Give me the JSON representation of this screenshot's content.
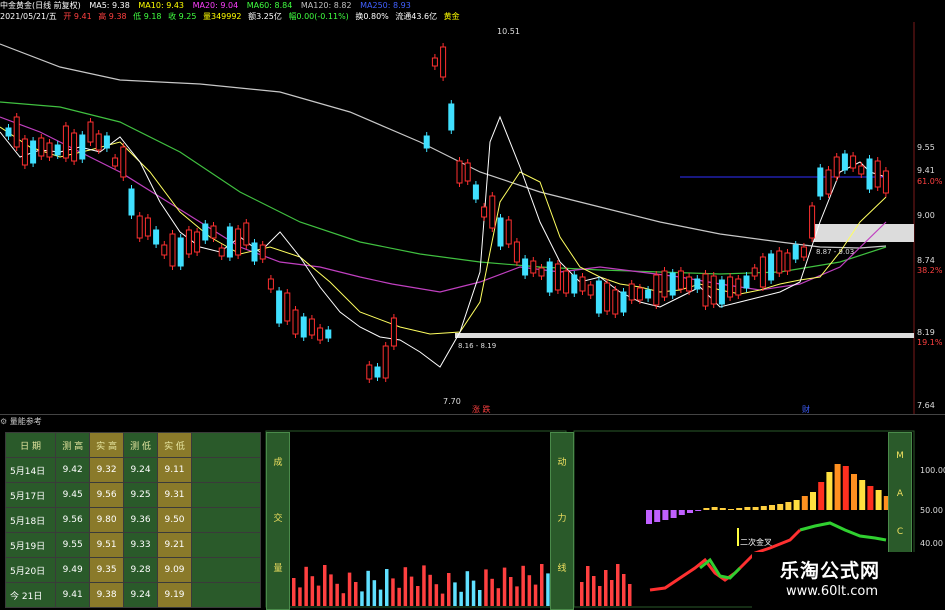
{
  "header": {
    "title": "中金黄金(日线 前复权)",
    "ma5": "MA5: 9.38",
    "ma10": "MA10: 9.43",
    "ma20": "MA20: 9.04",
    "ma60": "MA60: 8.84",
    "ma120": "MA120: 8.82",
    "ma250": "MA250: 8.93",
    "colors": {
      "ma5": "#ffffff",
      "ma10": "#ffff00",
      "ma20": "#ff40ff",
      "ma60": "#40ff40",
      "ma120": "#c0c0c0",
      "ma250": "#4060ff"
    }
  },
  "quote": {
    "date": "2021/05/21/五",
    "open": "开 9.41",
    "high": "高 9.38",
    "low": "低 9.18",
    "close": "收 9.25",
    "volume": "量349992",
    "amount": "额3.25亿",
    "change": "幅0.00(-0.11%)",
    "turnover": "换0.80%",
    "float_mcap": "流通43.6亿",
    "sector": "黄金"
  },
  "axis": {
    "labels": [
      "9.55",
      "9.41",
      "61.0%",
      "9.00",
      "8.74",
      "38.2%",
      "8.19",
      "19.1%",
      "7.64"
    ]
  },
  "chart_annotations": {
    "high_label": "10.51",
    "low_label": "7.70",
    "band1": "8.16 - 8.19",
    "band2": "8.87 - 9.03",
    "marker_red": "涨 跌",
    "marker_blue": "财"
  },
  "panel": {
    "title": "量能参考"
  },
  "table": {
    "headers": [
      "日 期",
      "测 高",
      "实 高",
      "测 低",
      "实 低"
    ],
    "rows": [
      [
        "5月14日",
        "9.42",
        "9.32",
        "9.24",
        "9.11"
      ],
      [
        "5月17日",
        "9.45",
        "9.56",
        "9.25",
        "9.31"
      ],
      [
        "5月18日",
        "9.56",
        "9.80",
        "9.36",
        "9.50"
      ],
      [
        "5月19日",
        "9.55",
        "9.51",
        "9.33",
        "9.21"
      ],
      [
        "5月20日",
        "9.49",
        "9.35",
        "9.28",
        "9.09"
      ],
      [
        "今 21日",
        "9.41",
        "9.38",
        "9.24",
        "9.19"
      ]
    ]
  },
  "side_labels": {
    "volume_label": [
      "成",
      "交",
      "量"
    ],
    "momentum_label": [
      "动",
      "力",
      "线"
    ],
    "mac_label": [
      "M",
      "A",
      "C"
    ],
    "annotation": "二次金叉",
    "right_axis": [
      "100.00",
      "50.00",
      "40.00"
    ]
  },
  "watermark": {
    "line1": "乐淘公式网",
    "line2": "www.60lt.com"
  }
}
